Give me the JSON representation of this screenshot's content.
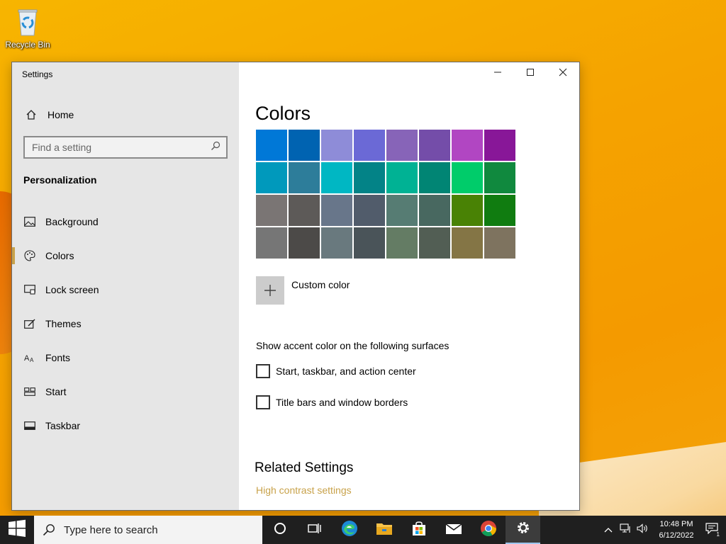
{
  "desktop": {
    "recycle_bin_label": "Recycle Bin"
  },
  "window": {
    "title": "Settings",
    "controls": [
      "minimize-icon",
      "maximize-icon",
      "close-icon"
    ]
  },
  "sidebar": {
    "home_label": "Home",
    "search_placeholder": "Find a setting",
    "section_title": "Personalization",
    "items": [
      {
        "label": "Background",
        "icon": "picture-icon",
        "active": false
      },
      {
        "label": "Colors",
        "icon": "palette-icon",
        "active": true
      },
      {
        "label": "Lock screen",
        "icon": "lock-screen-icon",
        "active": false
      },
      {
        "label": "Themes",
        "icon": "themes-icon",
        "active": false
      },
      {
        "label": "Fonts",
        "icon": "fonts-icon",
        "active": false
      },
      {
        "label": "Start",
        "icon": "start-layout-icon",
        "active": false
      },
      {
        "label": "Taskbar",
        "icon": "taskbar-icon",
        "active": false
      }
    ],
    "accent_color": "#c8a24a"
  },
  "main": {
    "title": "Colors",
    "swatches": [
      "#0078d7",
      "#0063b1",
      "#8e8cd8",
      "#6b69d6",
      "#8764b8",
      "#744da9",
      "#b146c2",
      "#881798",
      "#0099bc",
      "#2d7d9a",
      "#00b7c3",
      "#038387",
      "#00b294",
      "#018574",
      "#00cc6a",
      "#10893e",
      "#7a7574",
      "#5d5a58",
      "#68768a",
      "#515c6b",
      "#567c73",
      "#486860",
      "#498205",
      "#107c10",
      "#767676",
      "#4c4a48",
      "#69797e",
      "#4a5459",
      "#647c64",
      "#525e54",
      "#847545",
      "#7e735f"
    ],
    "custom_color_label": "Custom color",
    "surfaces_label": "Show accent color on the following surfaces",
    "checkboxes": [
      {
        "label": "Start, taskbar, and action center",
        "checked": false
      },
      {
        "label": "Title bars and window borders",
        "checked": false
      }
    ],
    "related_title": "Related Settings",
    "related_link": "High contrast settings"
  },
  "taskbar": {
    "search_placeholder": "Type here to search",
    "pinned": [
      "cortana-icon",
      "task-view-icon",
      "edge-icon",
      "file-explorer-icon",
      "store-icon",
      "mail-icon",
      "chrome-icon",
      "settings-icon"
    ],
    "time": "10:48 PM",
    "date": "6/12/2022",
    "notification_count": "1"
  }
}
